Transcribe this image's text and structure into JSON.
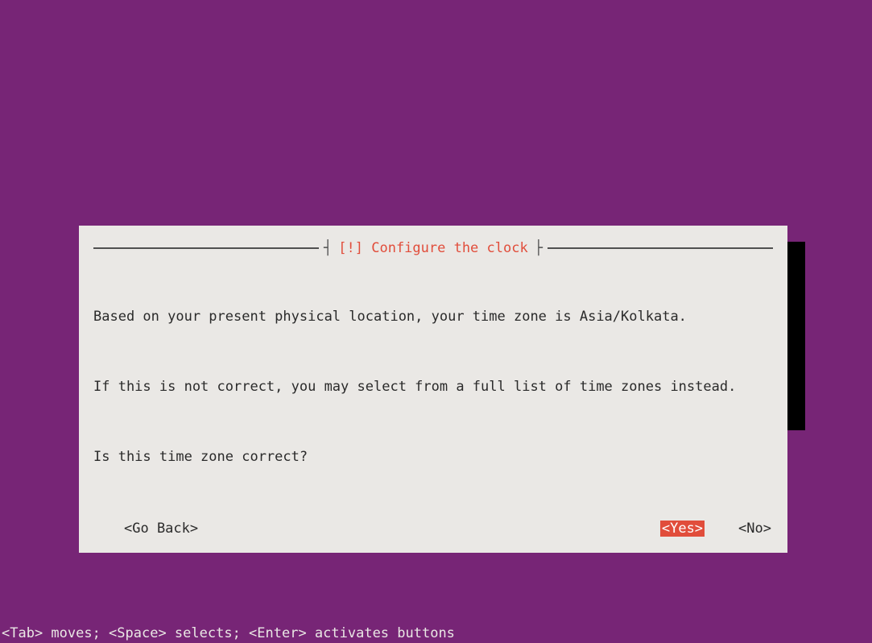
{
  "dialog": {
    "title": "[!] Configure the clock",
    "line1": "Based on your present physical location, your time zone is Asia/Kolkata.",
    "line2": "If this is not correct, you may select from a full list of time zones instead.",
    "line3": "Is this time zone correct?",
    "go_back": "<Go Back>",
    "yes": "<Yes>",
    "no": "<No>"
  },
  "statusbar": "<Tab> moves; <Space> selects; <Enter> activates buttons"
}
